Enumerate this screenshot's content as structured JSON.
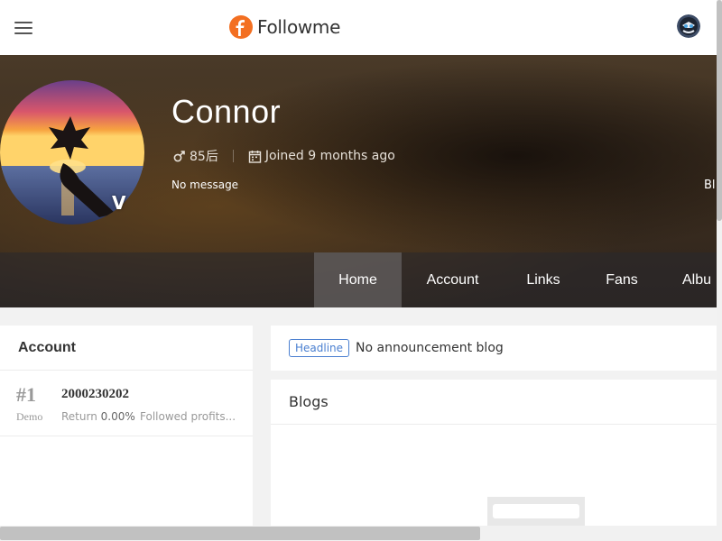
{
  "header": {
    "logo_text": "Followme",
    "brand_color": "#f36f21",
    "menu_icon": "hamburger-menu-icon",
    "avatar_icon": "user-avatar"
  },
  "profile": {
    "name": "Connor",
    "generation": "85后",
    "joined": "Joined 9 months ago",
    "signature": "No message",
    "badge": "V",
    "cut_text": "Bl"
  },
  "nav": {
    "tabs": [
      {
        "label": "Home",
        "active": true
      },
      {
        "label": "Account",
        "active": false
      },
      {
        "label": "Links",
        "active": false
      },
      {
        "label": "Fans",
        "active": false
      },
      {
        "label": "Albu",
        "active": false
      }
    ]
  },
  "account_card": {
    "title": "Account",
    "rows": [
      {
        "rank": "#1",
        "type": "Demo",
        "number": "2000230202",
        "return_label": "Return",
        "return_value": "0.00%",
        "followed": "Followed profits..."
      }
    ]
  },
  "announcement": {
    "tag": "Headline",
    "text": "No announcement blog",
    "tag_color": "#4a7fd0"
  },
  "blogs": {
    "title": "Blogs"
  }
}
